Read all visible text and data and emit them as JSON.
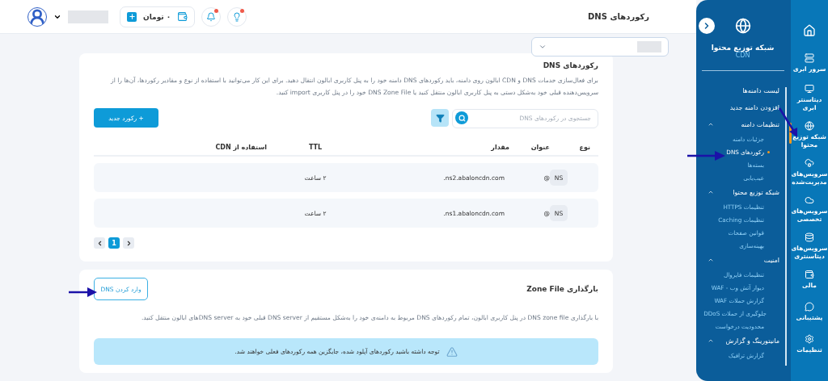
{
  "header": {
    "title": "رکوردهای DNS",
    "wallet": "۰ تومان",
    "notifications": {
      "unread": true
    },
    "tips": {
      "unread": true
    }
  },
  "rail": [
    {
      "selected": false
    },
    {
      "label": "سرور ابری",
      "selected": false
    },
    {
      "label": "دیتاسنتر ابری",
      "selected": false
    },
    {
      "label": "شبکه توزیع محتوا",
      "selected": true
    },
    {
      "label": "سرویس‌های مدیریت‌شده",
      "selected": false
    },
    {
      "label": "سرویس‌های تخصصی",
      "selected": false
    },
    {
      "label": "سرویس‌های دیتاسنتری",
      "selected": false
    },
    {
      "label": "مالی",
      "selected": false
    },
    {
      "label": "پشتیبانی",
      "selected": false
    },
    {
      "label": "تنظیمات",
      "selected": false
    }
  ],
  "sidebar": {
    "title": "شبکه توزیع محتوا",
    "subtitle": "CDN",
    "items": [
      {
        "label": "لیست دامنه‌ها",
        "selected": false
      },
      {
        "label": "افزودن دامنه جدید",
        "selected": false
      },
      {
        "label": "تنظیمات دامنه",
        "selected": false,
        "expanded": true,
        "children": [
          {
            "label": "جزئیات دامنه",
            "selected": false
          },
          {
            "label": "رکوردهای DNS",
            "selected": true
          },
          {
            "label": "بسته‌ها",
            "selected": false
          },
          {
            "label": "عیب‌یابی",
            "selected": false
          }
        ]
      },
      {
        "label": "شبکه توزیع محتوا",
        "selected": false,
        "expanded": true,
        "children": [
          {
            "label": "تنظیمات HTTPS",
            "selected": false
          },
          {
            "label": "تنظیمات Caching",
            "selected": false
          },
          {
            "label": "قوانین صفحات",
            "selected": false
          },
          {
            "label": "بهینه‌سازی",
            "selected": false
          }
        ]
      },
      {
        "label": "امنیت",
        "selected": false,
        "expanded": true,
        "children": [
          {
            "label": "تنظیمات فایروال",
            "selected": false
          },
          {
            "label": "دیوار آتش وب - WAF",
            "selected": false
          },
          {
            "label": "گزارش حملات WAF",
            "selected": false
          },
          {
            "label": "جلوگیری از حملات DDoS",
            "selected": false
          },
          {
            "label": "محدودیت درخواست",
            "selected": false
          }
        ]
      },
      {
        "label": "مانیتورینگ و گزارش",
        "selected": false,
        "expanded": true,
        "children": [
          {
            "label": "گزارش ترافیک",
            "selected": false
          }
        ]
      }
    ]
  },
  "records_card": {
    "title": "رکوردهای DNS",
    "description": "برای فعال‌سازی خدمات DNS و CDN ابالون روی دامنه، باید رکوردهای DNS دامنه خود را به پنل کاربری ابالون انتقال دهید. برای این کار می‌توانید با استفاده از نوع و مقادیر رکوردها، آن‌ها را از سرویس‌دهنده قبلی خود به‌شکل دستی به پنل کاربری ابالون منتقل کنید یا DNS Zone File خود را در پنل کاربری import کنید.",
    "search": {
      "placeholder": "جستجوی در رکوردهای DNS"
    },
    "new_button": "+ رکورد جدید",
    "table": {
      "columns": [
        "نوع",
        "عنوان",
        "مقدار",
        "TTL",
        "استفاده از CDN"
      ],
      "rows": [
        [
          "NS",
          "@",
          "ns2.abaloncdn.com.",
          "۲ ساعت"
        ],
        [
          "NS",
          "@",
          "ns1.abaloncdn.com.",
          "۲ ساعت"
        ]
      ]
    },
    "pages": [
      {
        "label": "1",
        "selected": true
      }
    ]
  },
  "zone_card": {
    "title": "بارگذاری Zone File",
    "button": "وارد کردن DNS",
    "description": "با بارگذاری DNS zone file در پنل کاربری ابالون، تمام رکوردهای DNS مربوط به دامنه‌ی خود را به‌شکل مستقیم از DNS server قبلی خود به DNS serverهای ابالون منتقل کنید.",
    "alert": "توجه داشته باشید رکوردهای آپلود شده، جایگزین همه رکوردهای فعلی خواهند شد."
  }
}
